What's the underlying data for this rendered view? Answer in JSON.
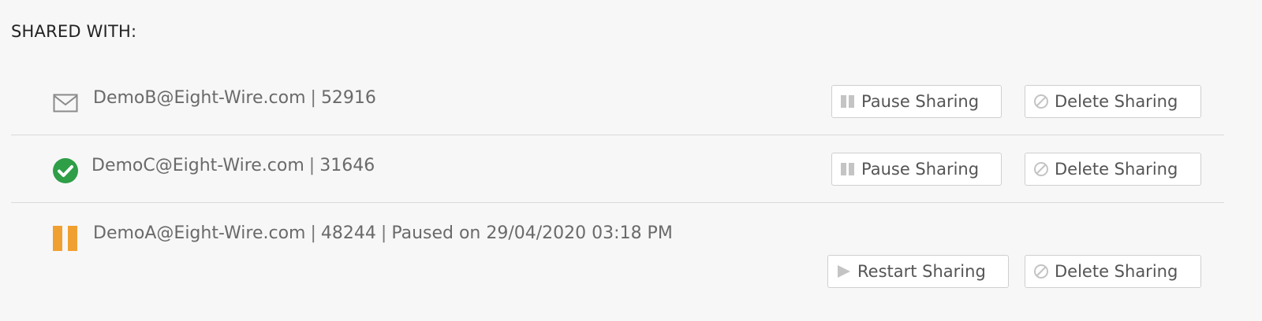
{
  "header": {
    "title": "SHARED WITH:"
  },
  "shares": [
    {
      "status_icon": "envelope-icon",
      "email": "DemoB@Eight-Wire.com",
      "separator": "|",
      "id": "52916",
      "primary_action": {
        "label": "Pause Sharing",
        "icon": "pause-icon"
      },
      "delete_action": {
        "label": "Delete Sharing",
        "icon": "ban-icon"
      }
    },
    {
      "status_icon": "check-circle-icon",
      "email": "DemoC@Eight-Wire.com",
      "separator": "|",
      "id": "31646",
      "primary_action": {
        "label": "Pause Sharing",
        "icon": "pause-icon"
      },
      "delete_action": {
        "label": "Delete Sharing",
        "icon": "ban-icon"
      }
    },
    {
      "status_icon": "paused-icon",
      "email": "DemoA@Eight-Wire.com",
      "separator": "|",
      "id": "48244",
      "separator2": "|",
      "paused_text": "Paused on 29/04/2020 03:18 PM",
      "primary_action": {
        "label": "Restart Sharing",
        "icon": "play-icon"
      },
      "delete_action": {
        "label": "Delete Sharing",
        "icon": "ban-icon"
      }
    }
  ],
  "colors": {
    "accepted_green": "#2e9e47",
    "paused_orange": "#f0a030",
    "button_icon_grey": "#c4c4c4",
    "row_text": "#6a6a6a"
  }
}
